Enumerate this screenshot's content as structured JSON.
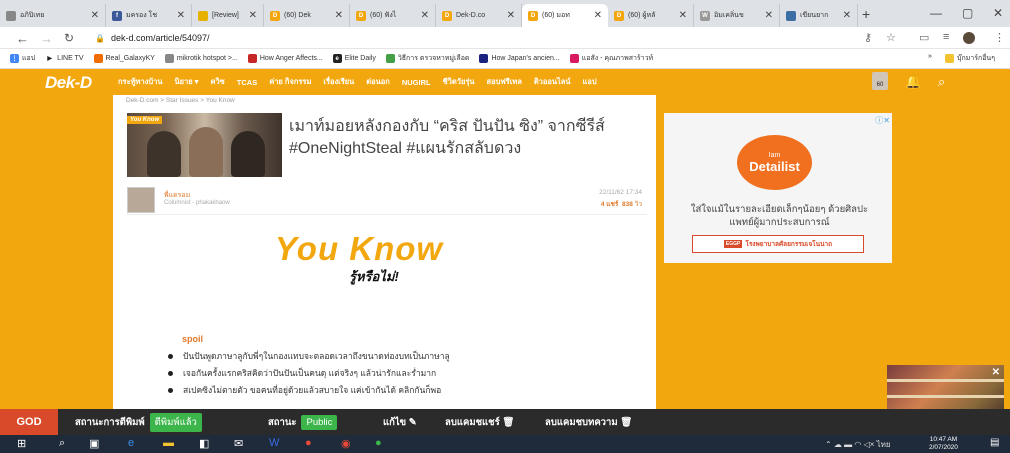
{
  "browser": {
    "tabs": [
      {
        "label": "อภิปิเทย",
        "icon_color": "#888",
        "icon_text": ""
      },
      {
        "label": "มครอง โช",
        "icon_color": "#3b5998",
        "icon_text": "f"
      },
      {
        "label": "[Review]",
        "icon_color": "#e8b100",
        "icon_text": ""
      },
      {
        "label": "(60) Dek",
        "icon_color": "#f3a70e",
        "icon_text": "D"
      },
      {
        "label": "(60) ฟังไ",
        "icon_color": "#f3a70e",
        "icon_text": "D"
      },
      {
        "label": "Dek-D.co",
        "icon_color": "#f3a70e",
        "icon_text": "D"
      },
      {
        "label": "(60) มอท",
        "icon_color": "#f3a70e",
        "icon_text": "D"
      },
      {
        "label": "(60) ผู้หลั",
        "icon_color": "#f3a70e",
        "icon_text": "D"
      },
      {
        "label": "อิมเคลิ่นข",
        "icon_color": "#999",
        "icon_text": "W"
      },
      {
        "label": "เขียนยาก",
        "icon_color": "#3a6ea5",
        "icon_text": ""
      }
    ],
    "new_tab": "+",
    "window_controls": [
      "—",
      "▢",
      "✕"
    ],
    "url": "dek-d.com/article/54097/",
    "bookmarks": [
      {
        "label": "แอป",
        "icon_color": "#4285f4",
        "icon_text": "⋮⋮"
      },
      {
        "label": "LINE TV",
        "icon_color": "#fff",
        "icon_text": "▶"
      },
      {
        "label": "Real_GalaxyKY",
        "icon_color": "#ef6c00",
        "icon_text": ""
      },
      {
        "label": "mikrotik hotspot >...",
        "icon_color": "#888",
        "icon_text": ""
      },
      {
        "label": "How Anger Affects...",
        "icon_color": "#c62828",
        "icon_text": ""
      },
      {
        "label": "Elite Daily",
        "icon_color": "#222",
        "icon_text": "e"
      },
      {
        "label": "วิธีการ ตรวจหาหมู่เลือด",
        "icon_color": "#43a047",
        "icon_text": ""
      },
      {
        "label": "How Japan's ancien...",
        "icon_color": "#1a237e",
        "icon_text": ""
      },
      {
        "label": "แอสัง - คุณภาพสาร้าวท์",
        "icon_color": "#d81b60",
        "icon_text": ""
      }
    ],
    "bookmarks_more": "»",
    "other_bookmarks": "บุ๊กมาร์กอื่นๆ"
  },
  "site": {
    "logo": "Dek-D",
    "nav": [
      "กระทู้ทางบ้าน",
      "นิยาย ▾",
      "ควิซ",
      "TCAS",
      "ค่าย กิจกรรม",
      "เรื่องเรียน",
      "ต่อนอก",
      "NUGIRL",
      "ชีวิตวัยรุ่น",
      "สอบฟรีเทล",
      "ติวออนไลน์",
      "แอป"
    ],
    "avatar_badge": "60"
  },
  "article": {
    "breadcrumb": "Dek-D.com > Star Issues > You Know",
    "thumb_tag": "You Know",
    "title": "เมาท์มอยหลังกองกับ “คริส ปันปัน ซิง” จากซีรีส์ #OneNightSteal #แผนรักสลับดวง",
    "author_name": "พี่แดรอม",
    "author_role": "Columnist - phakakhaow",
    "date": "22/11/62 17:34",
    "stats_prefix": "4 แชร์",
    "views": "838",
    "views_suffix": "วิว",
    "hero_main": "You Know",
    "hero_sub": "รู้หรือไม่!",
    "spoil_label": "spoil",
    "bullets": [
      "ปันปันพูดภาษาลูกับพี่ๆในกองแทบจะตลอดเวลาถึงขนาดท่องบทเป็นภาษาลู",
      "เจอกันครั้งแรกคริสคิดว่าปันปันเป็นคนดุ แต่จริงๆ แล้วน่ารักและร่ำมาก",
      "สเปคซิงไม่ตายตัว ขอคนที่อยู่ด้วยแล้วสบายใจ แค่เข้ากันได้ คลิกกันก็พอ"
    ]
  },
  "ad": {
    "close": "ⓘ✕",
    "logo_top": "Iam",
    "logo_main": "Detailist",
    "text": "ใส่ใจแม้ในรายละเอียดเล็กๆน้อยๆ ด้วยศิลปะแพทย์ผู้มากประสบการณ์",
    "btn_tag": "EGGP",
    "btn_label": "โรงพยาบาลศัลยกรรมเจโนนาถ"
  },
  "statbar": {
    "god": "GOD",
    "print_status": "สถานะการตีพิมพ์",
    "print_value": "ตีพิมพ์แล้ว",
    "status": "สถานะ",
    "status_value": "Public",
    "edit": "แก้ไข",
    "delete_share": "ลบแคมชแชร์",
    "delete_article": "ลบแคมชบทความ"
  },
  "taskbar": {
    "time": "10:47 AM",
    "date": "2/07/2020",
    "lang": "ไทย"
  }
}
